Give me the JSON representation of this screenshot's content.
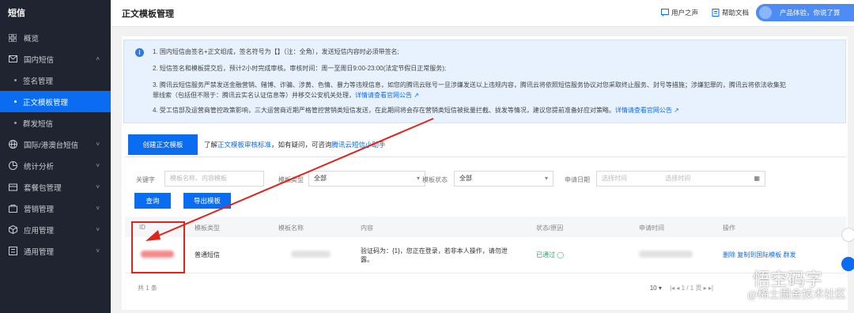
{
  "sidebar": {
    "title": "短信",
    "items": [
      {
        "label": "概览",
        "icon": "grid-icon"
      },
      {
        "label": "国内短信",
        "icon": "envelope-icon",
        "chevron": "˄"
      },
      {
        "label": "签名管理",
        "sub": true
      },
      {
        "label": "正文模板管理",
        "sub": true,
        "active": true
      },
      {
        "label": "群发短信",
        "sub": true
      },
      {
        "label": "国际/港澳台短信",
        "icon": "globe-icon",
        "chevron": "˅"
      },
      {
        "label": "统计分析",
        "icon": "chart-icon",
        "chevron": "˅"
      },
      {
        "label": "套餐包管理",
        "icon": "package-icon",
        "chevron": "˅"
      },
      {
        "label": "营销管理",
        "icon": "bag-icon",
        "chevron": "˅"
      },
      {
        "label": "应用管理",
        "icon": "cube-icon",
        "chevron": "˅"
      },
      {
        "label": "通用管理",
        "icon": "settings-icon",
        "chevron": "˅"
      }
    ]
  },
  "header": {
    "title": "正文模板管理",
    "user_voice": "用户之声",
    "help_docs": "帮助文档",
    "promo": "产品体验，你说了算"
  },
  "notice": {
    "lines": [
      {
        "text": "1. 国内短信由签名+正文组成，签名符号为【】（注：全角），发送短信内容时必须带签名;",
        "link": ""
      },
      {
        "text": "2. 短信签名和模板提交后，预计2小时完成审核。审核时间：周一至周日9:00-23:00(法定节假日正常服务);",
        "link": ""
      },
      {
        "text": "3. 腾讯云短信服务严禁发送金融营销、赌博、诈骗、涉黄、色情、暴力等违规信息，如您的腾讯云账号一旦涉嫌发送以上违规内容，腾讯云将依照短信服务协议对您采取终止服务、封号等措施；涉嫌犯罪的，腾讯云将依法收集犯",
        "link": ""
      },
      {
        "text": "罪线索（包括但不限于：腾讯云实名认证信息等）并移交公安机关处理，",
        "link": "详情请查看官网公告"
      },
      {
        "text": "4. 受工信部及运营商管控政策影响，三大运营商近期严格管控营销类短信发送，在此期间将会存在营销类短信被批量拦截、拢发等情况，建议您提前准备好应对策略。",
        "link": "详情请查看官网公告"
      }
    ]
  },
  "toolbar": {
    "create_button": "创建正文模板",
    "tip_prefix": "了解",
    "tip_link1": "正文模板审核标准",
    "tip_middle": "，如有疑问，可咨询",
    "tip_link2": "腾讯云短信小助手"
  },
  "filters": {
    "keyword_label": "关键字",
    "keyword_placeholder": "模板名称、内容模板",
    "type_label": "模板类型",
    "type_value": "全部",
    "status_label": "模板状态",
    "status_value": "全部",
    "date_label": "申请日期",
    "start_placeholder": "选择时间",
    "end_placeholder": "选择时间",
    "query_button": "查询",
    "export_button": "导出模板"
  },
  "table": {
    "headers": [
      "ID",
      "模板类型",
      "模板名称",
      "内容",
      "状态/原因",
      "申请时间",
      "操作"
    ],
    "rows": [
      {
        "type": "普通短信",
        "content_line1": "验证码为：{1}，您正在登录，若非本人操作，请勿泄",
        "content_line2": "露。",
        "status": "已通过",
        "ops": [
          "删除",
          "复制到国际模板",
          "群发"
        ]
      }
    ]
  },
  "footer": {
    "total": "共 1 条",
    "page_size": "10",
    "page_nav": "|◂ ◂ 1 / 1 页 ▸ ▸|"
  },
  "watermark": {
    "line1": "悟空码字",
    "line2": "@稀土掘金技术社区"
  }
}
